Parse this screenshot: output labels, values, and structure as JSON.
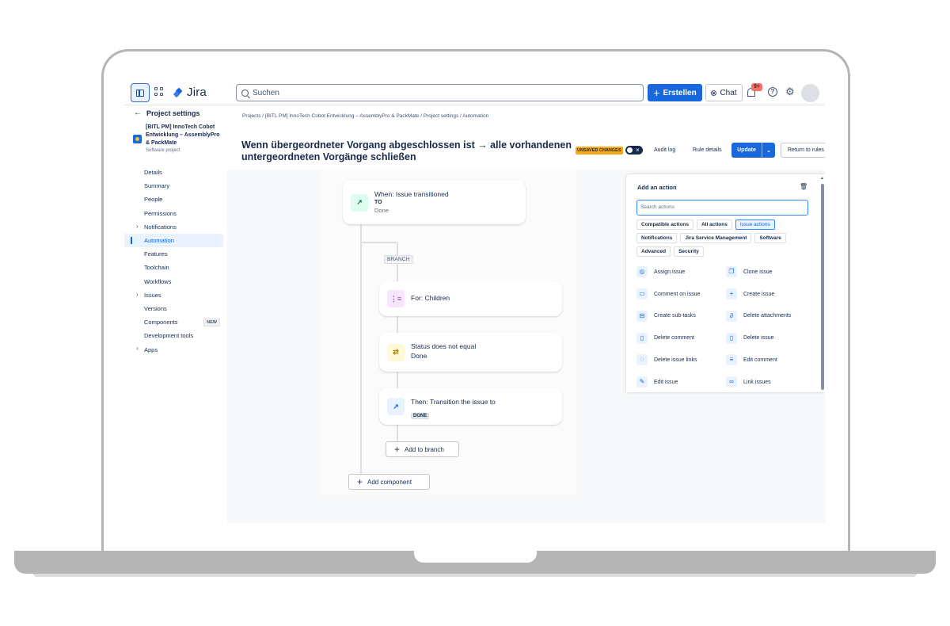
{
  "topnav": {
    "logo": "Jira",
    "search_placeholder": "Suchen",
    "create_label": "Erstellen",
    "chat_label": "Chat",
    "notifications_badge": "9+",
    "help_glyph": "?"
  },
  "sidebar": {
    "back_label": "Project settings",
    "project_name": "[BITL PM] InnoTech Cobot Entwicklung – AssemblyPro & PackMate",
    "project_type": "Software project",
    "items": [
      {
        "label": "Details",
        "expandable": false,
        "active": false
      },
      {
        "label": "Summary",
        "expandable": false,
        "active": false
      },
      {
        "label": "People",
        "expandable": false,
        "active": false
      },
      {
        "label": "Permissions",
        "expandable": false,
        "active": false
      },
      {
        "label": "Notifications",
        "expandable": true,
        "active": false
      },
      {
        "label": "Automation",
        "expandable": false,
        "active": true
      },
      {
        "label": "Features",
        "expandable": false,
        "active": false
      },
      {
        "label": "Toolchain",
        "expandable": false,
        "active": false
      },
      {
        "label": "Workflows",
        "expandable": false,
        "active": false
      },
      {
        "label": "Issues",
        "expandable": true,
        "active": false
      },
      {
        "label": "Versions",
        "expandable": false,
        "active": false
      },
      {
        "label": "Components",
        "expandable": false,
        "active": false,
        "badge": "NEW"
      },
      {
        "label": "Development tools",
        "expandable": false,
        "active": false
      },
      {
        "label": "Apps",
        "expandable": true,
        "active": false
      }
    ]
  },
  "breadcrumb": "Projects  /  [BITL PM] InnoTech Cobot Entwicklung – AssemblyPro & PackMate  /  Project settings  /  Automation",
  "rule": {
    "title": "Wenn übergeordneter Vorgang abgeschlossen ist → alle vorhandenen untergeordneten Vorgänge schließen",
    "unsaved_label": "UNSAVED CHANGES",
    "audit_log": "Audit log",
    "rule_details": "Rule details",
    "update_label": "Update",
    "return_label": "Return to rules"
  },
  "flow": {
    "trigger": {
      "title": "When: Issue transitioned",
      "to_label": "TO",
      "to_value": "Done"
    },
    "branch_label": "BRANCH",
    "branch": {
      "title": "For: Children"
    },
    "condition": {
      "title": "Status does not equal",
      "value": "Done"
    },
    "action": {
      "title": "Then: Transition the issue to",
      "value": "DONE"
    },
    "add_to_branch": "Add to branch",
    "add_component": "Add component"
  },
  "panel": {
    "title": "Add an action",
    "search_placeholder": "Search actions",
    "filters_row1": [
      "Compatible actions",
      "All actions",
      "Issue actions"
    ],
    "filters_row2": [
      "Notifications",
      "Jira Service Management",
      "Software"
    ],
    "filters_row3": [
      "Advanced",
      "Security"
    ],
    "selected_filter": "Issue actions",
    "actions": [
      {
        "label": "Assign issue",
        "icon": "user-icon"
      },
      {
        "label": "Clone issue",
        "icon": "copy-icon"
      },
      {
        "label": "Comment on issue",
        "icon": "comment-icon"
      },
      {
        "label": "Create issue",
        "icon": "plus-icon"
      },
      {
        "label": "Create sub-tasks",
        "icon": "subtask-icon"
      },
      {
        "label": "Delete attachments",
        "icon": "paperclip-icon"
      },
      {
        "label": "Delete comment",
        "icon": "trash-icon"
      },
      {
        "label": "Delete issue",
        "icon": "trash-icon"
      },
      {
        "label": "Delete issue links",
        "icon": "unlink-icon"
      },
      {
        "label": "Edit comment",
        "icon": "comment-edit-icon"
      },
      {
        "label": "Edit issue",
        "icon": "edit-icon"
      },
      {
        "label": "Link issues",
        "icon": "link-icon"
      }
    ]
  },
  "colors": {
    "brand": "#1868db",
    "unsaved": "#f8a816",
    "trigger_icon_bg": "#dcfff1",
    "branch_icon_bg": "#f8e6ff",
    "condition_icon_bg": "#fff7d6",
    "action_icon_bg": "#e9f2ff"
  }
}
